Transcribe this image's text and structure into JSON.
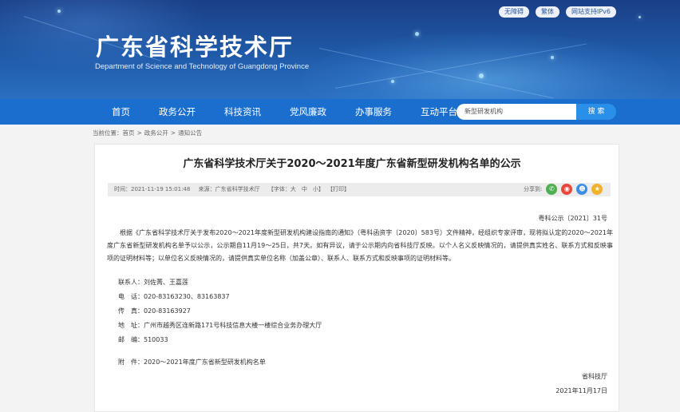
{
  "header": {
    "site_title": "广东省科学技术厅",
    "site_subtitle": "Department of Science and Technology of Guangdong Province",
    "top_links": [
      "无障碍",
      "繁体",
      "网站支持IPv6"
    ]
  },
  "nav": {
    "items": [
      "首页",
      "政务公开",
      "科技资讯",
      "党风廉政",
      "办事服务",
      "互动平台"
    ]
  },
  "search": {
    "value": "新型研发机构",
    "button_label": "搜 索"
  },
  "breadcrumb": {
    "prefix": "当前位置：",
    "items": [
      "首页",
      "政务公开",
      "通知公告"
    ],
    "separator": ">"
  },
  "article": {
    "title": "广东省科学技术厅关于2020～2021年度广东省新型研发机构名单的公示",
    "meta": {
      "time": "时间：2021-11-19 15:01:48",
      "source": "来源：广东省科学技术厅",
      "font_size": "【字体：大　中　小】",
      "print": "【打印】"
    },
    "share_label": "分享到:",
    "doc_no": "粤科公示〔2021〕31号",
    "body": "根据《广东省科学技术厅关于发布2020～2021年度新型研发机构建设指南的通知》（粤科函资字〔2020〕583号）文件精神，经组织专家评审，现将拟认定的2020～2021年度广东省新型研发机构名单予以公示，公示期自11月19～25日，共7天。如有异议，请于公示期内向省科技厅反映。以个人名义反映情况的，请提供真实姓名、联系方式和反映事项的证明材料等；以单位名义反映情况的，请提供真实单位名称（加盖公章）、联系人、联系方式和反映事项的证明材料等。",
    "contact": {
      "contact_person": "联系人：刘佐菁、王嘉莲",
      "phone": "电　话：020-83163230、83163837",
      "fax": "传　真：020-83163927",
      "address": "地　址：广州市越秀区连新路171号科技信息大楼一楼综合业务办理大厅",
      "postcode": "邮　编：510033"
    },
    "attachment": "附　件：2020～2021年度广东省新型研发机构名单",
    "signature": "省科技厅",
    "date": "2021年11月17日"
  },
  "colors": {
    "nav_bg": "#1a6fce",
    "banner_bg": "#1f5aa8",
    "search_button": "#2a8fe8",
    "share_wechat": "#4caf50",
    "share_weibo": "#e8483b",
    "share_qq": "#3a8ee6",
    "share_qzone": "#f2b12a"
  },
  "icons": [
    "wechat-icon",
    "weibo-icon",
    "qq-icon",
    "qzone-icon"
  ]
}
